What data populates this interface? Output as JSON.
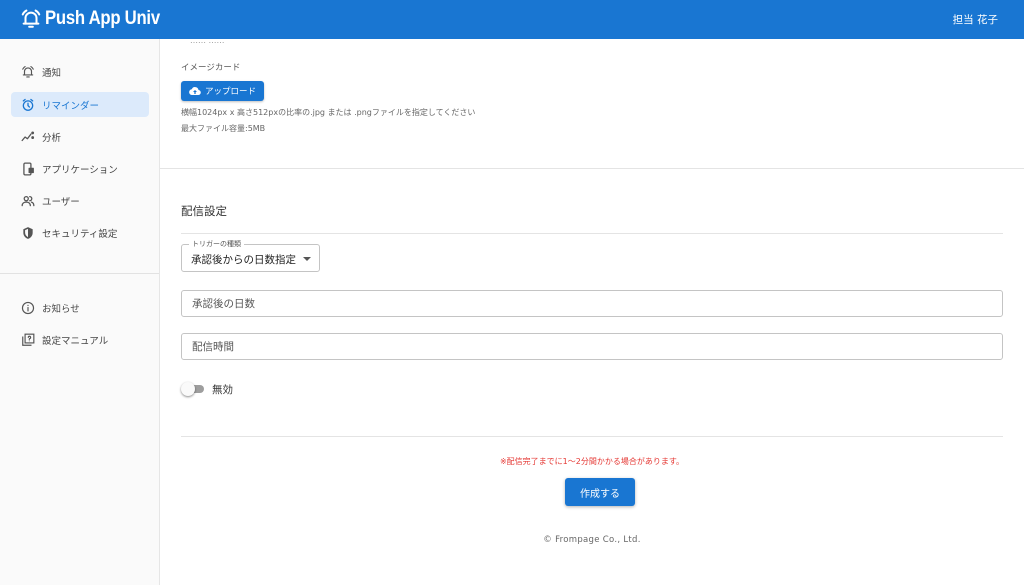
{
  "app": {
    "title": "Push App Univ",
    "user": "担当 花子"
  },
  "sidebar": {
    "items": [
      {
        "label": "通知",
        "icon": "bell-icon",
        "active": false
      },
      {
        "label": "リマインダー",
        "icon": "alarm-clock-icon",
        "active": true
      },
      {
        "label": "分析",
        "icon": "analytics-icon",
        "active": false
      },
      {
        "label": "アプリケーション",
        "icon": "mobile-app-icon",
        "active": false
      },
      {
        "label": "ユーザー",
        "icon": "users-icon",
        "active": false
      },
      {
        "label": "セキュリティ設定",
        "icon": "shield-icon",
        "active": false
      }
    ],
    "secondary": [
      {
        "label": "お知らせ",
        "icon": "info-icon"
      },
      {
        "label": "設定マニュアル",
        "icon": "manual-icon"
      }
    ]
  },
  "image_card": {
    "truncated_text": "…… ……",
    "label": "イメージカード",
    "upload_label": "アップロード",
    "hint_size": "横幅1024px x 高さ512pxの比率の.jpg または .pngファイルを指定してください",
    "hint_max": "最大ファイル容量:5MB"
  },
  "delivery": {
    "section_title": "配信設定",
    "trigger": {
      "legend": "トリガーの種類",
      "value": "承認後からの日数指定"
    },
    "days_placeholder": "承認後の日数",
    "time_placeholder": "配信時間",
    "toggle": {
      "label": "無効",
      "enabled": false
    }
  },
  "notice": "※配信完了までに1〜2分間かかる場合があります。",
  "submit_label": "作成する",
  "footer": "© Frompage Co., Ltd.",
  "colors": {
    "primary": "#1976d2",
    "active_bg": "#dceafb",
    "notice": "#e53935"
  }
}
